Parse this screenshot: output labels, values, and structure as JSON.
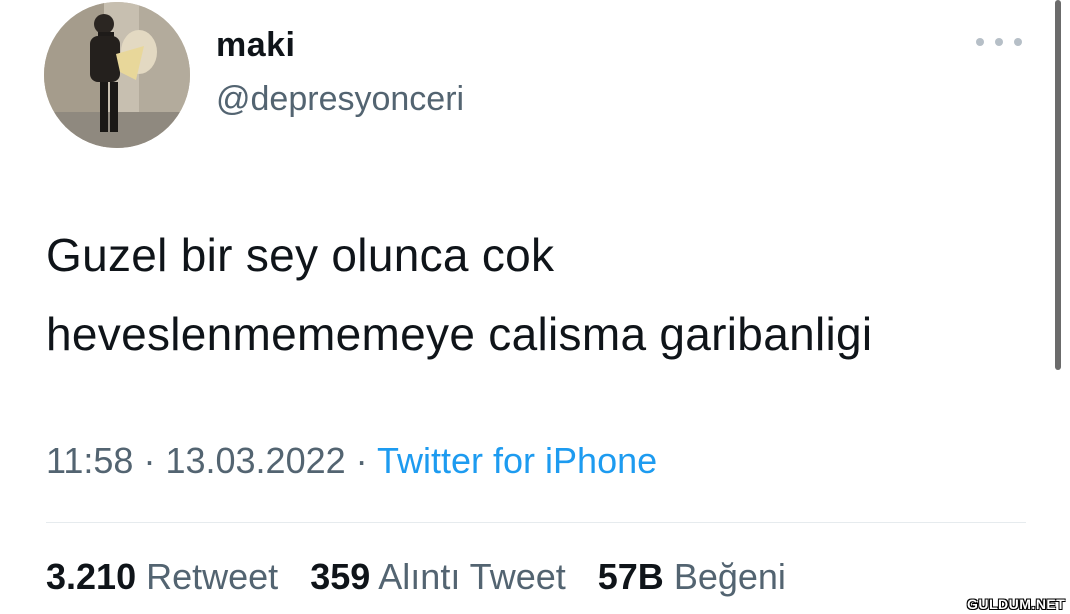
{
  "author": {
    "display_name": "maki",
    "handle": "@depresyonceri",
    "avatar_icon": "profile-photo"
  },
  "more_icon": "more-horizontal-icon",
  "tweet": {
    "lines": [
      "Guzel bir sey olunca cok",
      "heveslenmememeye calisma garibanligi"
    ]
  },
  "meta": {
    "time": "11:58",
    "separator": "·",
    "date": "13.03.2022",
    "source": "Twitter for iPhone"
  },
  "stats": {
    "retweets_count": "3.210",
    "retweets_label": "Retweet",
    "quotes_count": "359",
    "quotes_label": "Alıntı Tweet",
    "likes_count": "57B",
    "likes_label": "Beğeni"
  },
  "watermark": "GULDUM.NET",
  "colors": {
    "text": "#0f1419",
    "secondary": "#536471",
    "link": "#1d9bf0",
    "divider": "#e6ebee"
  }
}
